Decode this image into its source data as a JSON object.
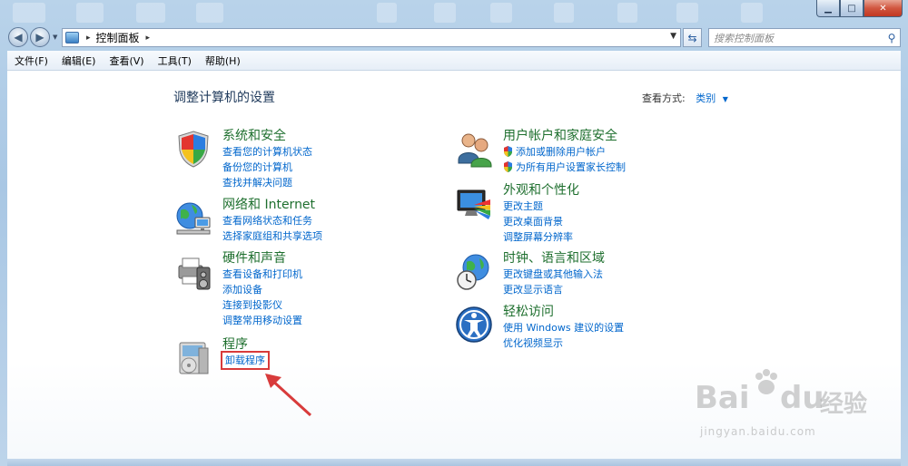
{
  "window": {
    "min_glyph": "▁",
    "max_glyph": "□",
    "close_glyph": "✕"
  },
  "address": {
    "crumbs": [
      "控制面板"
    ],
    "separator": "▸",
    "search_placeholder": "搜索控制面板"
  },
  "menubar": {
    "items": [
      "文件(F)",
      "编辑(E)",
      "查看(V)",
      "工具(T)",
      "帮助(H)"
    ]
  },
  "main": {
    "heading": "调整计算机的设置",
    "view_by_label": "查看方式:",
    "view_by_value": "类别"
  },
  "categories": [
    {
      "id": "system-security",
      "icon": "shield-icon",
      "title": "系统和安全",
      "links": [
        "查看您的计算机状态",
        "备份您的计算机",
        "查找并解决问题"
      ]
    },
    {
      "id": "network",
      "icon": "network-globe-icon",
      "title": "网络和 Internet",
      "links": [
        "查看网络状态和任务",
        "选择家庭组和共享选项"
      ]
    },
    {
      "id": "hardware",
      "icon": "printer-speaker-icon",
      "title": "硬件和声音",
      "links": [
        "查看设备和打印机",
        "添加设备",
        "连接到投影仪",
        "调整常用移动设置"
      ]
    },
    {
      "id": "programs",
      "icon": "programs-disc-icon",
      "title": "程序",
      "links": [
        "卸载程序"
      ]
    },
    {
      "id": "user-accounts",
      "icon": "users-icon",
      "title": "用户帐户和家庭安全",
      "links": [
        "添加或删除用户帐户",
        "为所有用户设置家长控制"
      ]
    },
    {
      "id": "appearance",
      "icon": "monitor-palette-icon",
      "title": "外观和个性化",
      "links": [
        "更改主题",
        "更改桌面背景",
        "调整屏幕分辨率"
      ]
    },
    {
      "id": "clock",
      "icon": "globe-clock-icon",
      "title": "时钟、语言和区域",
      "links": [
        "更改键盘或其他输入法",
        "更改显示语言"
      ]
    },
    {
      "id": "ease",
      "icon": "ease-of-access-icon",
      "title": "轻松访问",
      "links": [
        "使用 Windows 建议的设置",
        "优化视频显示"
      ]
    }
  ],
  "watermark": {
    "brand": "Bai",
    "brand2": "du",
    "brand_cn": "经验",
    "url": "jingyan.baidu.com"
  },
  "colors": {
    "category_title": "#1e6f2e",
    "link": "#0066cc",
    "heading": "#1e395b",
    "annotation_red": "#d83b3b"
  }
}
